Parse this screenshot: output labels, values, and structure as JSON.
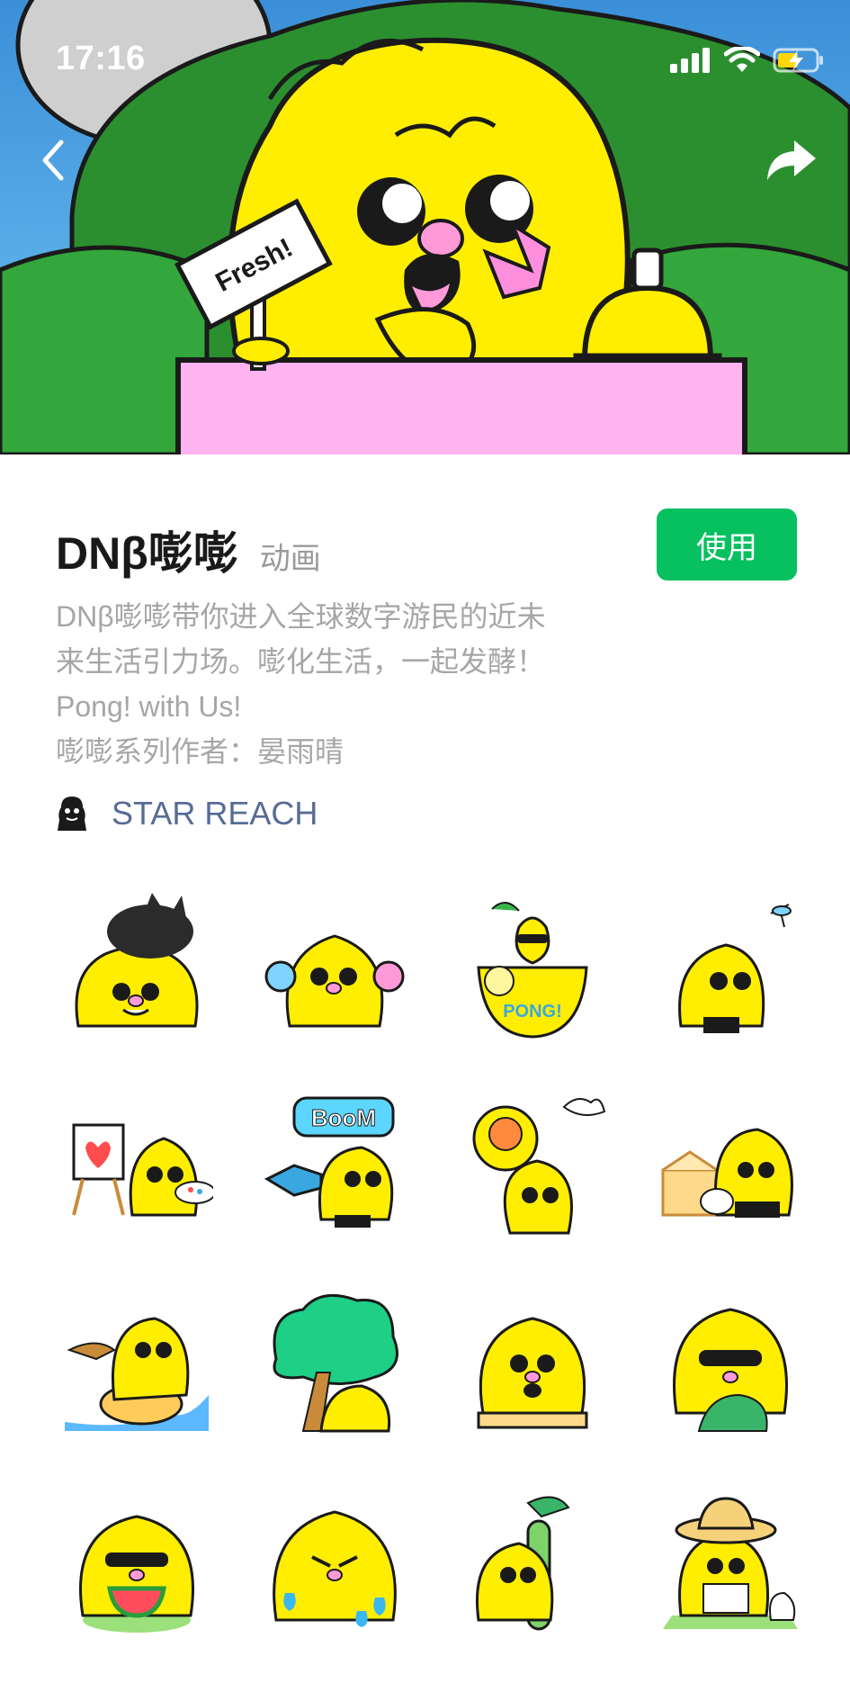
{
  "status_bar": {
    "time": "17:16",
    "icons": [
      "signal-icon",
      "wifi-icon",
      "battery-charging-icon"
    ]
  },
  "banner": {
    "sign_text": "Fresh!",
    "colors": {
      "sky": "#4fa6e8",
      "hill": "#2f9a3c",
      "character": "#ffee00",
      "counter": "#ffb3f0"
    }
  },
  "nav": {
    "back_icon": "chevron-left-icon",
    "share_icon": "share-arrow-icon"
  },
  "pack": {
    "title": "DNβ嘭嘭",
    "tag": "动画",
    "use_button": "使用",
    "description_lines": [
      "DNβ嘭嘭带你进入全球数字游民的近未",
      "来生活引力场。嘭化生活，一起发酵！",
      "Pong! with Us!",
      "嘭嘭系列作者：晏雨晴"
    ],
    "author": "STAR REACH"
  },
  "stickers": [
    {
      "name": "sticker-cat-on-head",
      "label": ""
    },
    {
      "name": "sticker-rainbow-earmuffs",
      "label": ""
    },
    {
      "name": "sticker-lemon-drink",
      "label": "PONG!"
    },
    {
      "name": "sticker-mosquito",
      "label": ""
    },
    {
      "name": "sticker-painting",
      "label": ""
    },
    {
      "name": "sticker-boom-horn",
      "label": "BooM"
    },
    {
      "name": "sticker-sunflower",
      "label": ""
    },
    {
      "name": "sticker-honey-box",
      "label": ""
    },
    {
      "name": "sticker-duck-surfing",
      "label": ""
    },
    {
      "name": "sticker-under-tree",
      "label": ""
    },
    {
      "name": "sticker-sitting-stool",
      "label": ""
    },
    {
      "name": "sticker-sunglasses-grass",
      "label": ""
    },
    {
      "name": "sticker-watermelon",
      "label": ""
    },
    {
      "name": "sticker-crying",
      "label": ""
    },
    {
      "name": "sticker-cactus-hug",
      "label": ""
    },
    {
      "name": "sticker-straw-hat-reading",
      "label": ""
    }
  ],
  "colors": {
    "accent": "#07c160",
    "link": "#576b95",
    "muted": "#a6a6a6"
  }
}
